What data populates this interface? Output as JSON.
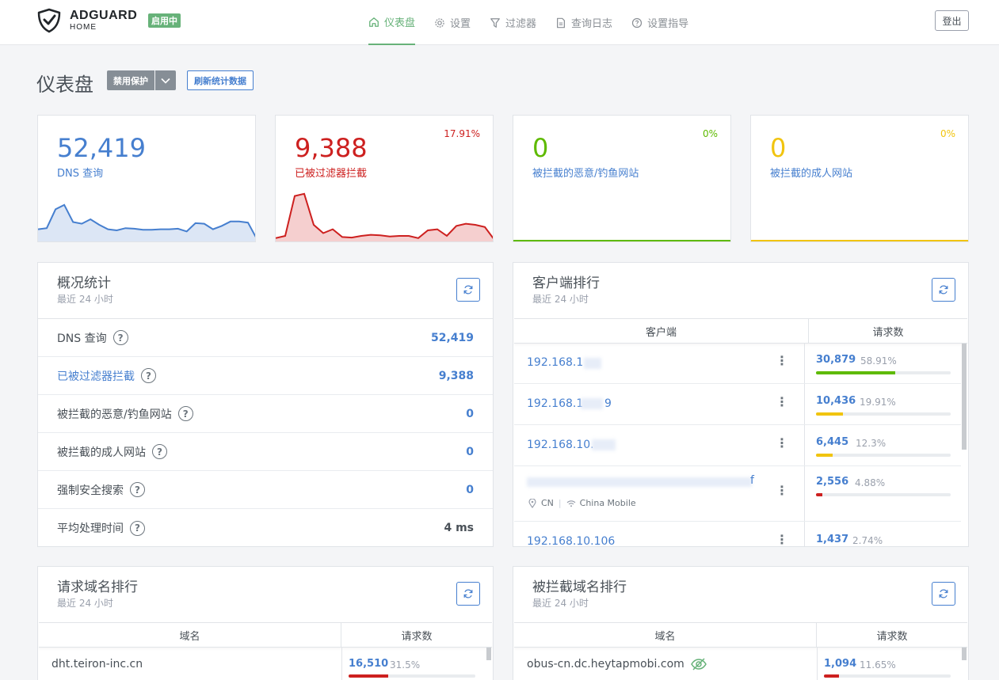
{
  "header": {
    "logo_title": "ADGUARD",
    "logo_sub": "HOME",
    "status_badge": "启用中",
    "nav": [
      {
        "label": "仪表盘",
        "icon": "home-icon",
        "active": true
      },
      {
        "label": "设置",
        "icon": "gear-icon",
        "active": false
      },
      {
        "label": "过滤器",
        "icon": "filter-icon",
        "active": false
      },
      {
        "label": "查询日志",
        "icon": "document-icon",
        "active": false
      },
      {
        "label": "设置指导",
        "icon": "help-circle-icon",
        "active": false
      }
    ],
    "logout_label": "登出"
  },
  "page": {
    "title": "仪表盘",
    "disable_label": "禁用保护",
    "refresh_label": "刷新统计数据"
  },
  "stat_cards": [
    {
      "value": "52,419",
      "label": "DNS 查询",
      "percent": "",
      "color": "#467fcf",
      "fill": "#dce6f5",
      "series": [
        0.22,
        0.24,
        0.58,
        0.66,
        0.35,
        0.32,
        0.4,
        0.3,
        0.22,
        0.2,
        0.24,
        0.23,
        0.21,
        0.21,
        0.22,
        0.22,
        0.23,
        0.18,
        0.33,
        0.32,
        0.22,
        0.28,
        0.36,
        0.36,
        0.34,
        0.05
      ]
    },
    {
      "value": "9,388",
      "label": "已被过滤器拦截",
      "percent": "17.91%",
      "color": "#cd201f",
      "fill": "#f5cfcf",
      "series": [
        0.06,
        0.1,
        0.82,
        0.86,
        0.3,
        0.15,
        0.22,
        0.08,
        0.07,
        0.1,
        0.12,
        0.11,
        0.09,
        0.1,
        0.1,
        0.06,
        0.2,
        0.22,
        0.1,
        0.28,
        0.32,
        0.3,
        0.26,
        0.03
      ]
    },
    {
      "value": "0",
      "label": "被拦截的恶意/钓鱼网站",
      "percent": "0%",
      "color": "#5eba00",
      "fill": "",
      "series": []
    },
    {
      "value": "0",
      "label": "被拦截的成人网站",
      "percent": "0%",
      "color": "#f1c40f",
      "fill": "",
      "series": []
    }
  ],
  "stats_panel": {
    "title": "概况统计",
    "subtitle": "最近 24 小时",
    "rows": [
      {
        "label": "DNS 查询",
        "value": "52,419"
      },
      {
        "label": "已被过滤器拦截",
        "value": "9,388"
      },
      {
        "label": "被拦截的恶意/钓鱼网站",
        "value": "0"
      },
      {
        "label": "被拦截的成人网站",
        "value": "0"
      },
      {
        "label": "强制安全搜索",
        "value": "0"
      },
      {
        "label": "平均处理时间",
        "value": "4 ms"
      }
    ]
  },
  "clients_panel": {
    "title": "客户端排行",
    "subtitle": "最近 24 小时",
    "col_client": "客户端",
    "col_requests": "请求数",
    "rows": [
      {
        "ip": "192.168.1",
        "count": "30,879",
        "pct": "58.91%",
        "fraction": 0.5891,
        "color": "#5eba00"
      },
      {
        "ip": "192.168.1",
        "ip_tail": "9",
        "count": "10,436",
        "pct": "19.91%",
        "fraction": 0.1991,
        "color": "#f1c40f"
      },
      {
        "ip": "192.168.10.",
        "count": "6,445",
        "pct": "12.3%",
        "fraction": 0.123,
        "color": "#f1c40f"
      },
      {
        "ip": "",
        "ip_tail": "f",
        "country": "CN",
        "isp": "China Mobile",
        "count": "2,556",
        "pct": "4.88%",
        "fraction": 0.0488,
        "color": "#cd201f"
      },
      {
        "ip": "192.168.10.106",
        "count": "1,437",
        "pct": "2.74%",
        "fraction": 0.0274,
        "color": "#cd201f"
      }
    ]
  },
  "domains_panel": {
    "title": "请求域名排行",
    "subtitle": "最近 24 小时",
    "col_domain": "域名",
    "col_requests": "请求数",
    "rows": [
      {
        "domain": "dht.teiron-inc.cn",
        "count": "16,510",
        "pct": "31.5%",
        "fraction": 0.315,
        "color": "#cd201f"
      }
    ]
  },
  "blocked_panel": {
    "title": "被拦截域名排行",
    "subtitle": "最近 24 小时",
    "col_domain": "域名",
    "col_requests": "请求数",
    "rows": [
      {
        "domain": "obus-cn.dc.heytapmobi.com",
        "count": "1,094",
        "pct": "11.65%",
        "fraction": 0.1165,
        "color": "#cd201f"
      }
    ]
  }
}
